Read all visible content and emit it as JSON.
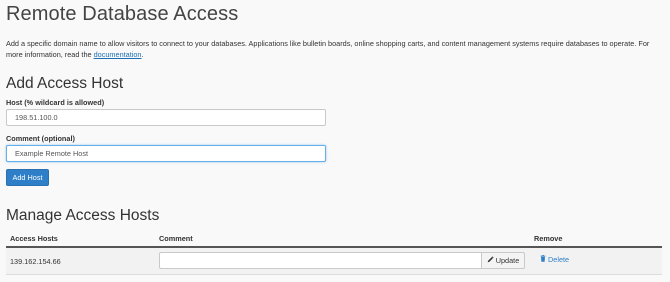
{
  "page": {
    "title": "Remote Database Access",
    "intro_text": "Add a specific domain name to allow visitors to connect to your databases. Applications like bulletin boards, online shopping carts, and content management systems require databases to operate. For more information, read the ",
    "intro_link": "documentation",
    "intro_end": "."
  },
  "add_section": {
    "heading": "Add Access Host",
    "host_label": "Host (% wildcard is allowed)",
    "host_value": "198.51.100.0",
    "comment_label": "Comment (optional)",
    "comment_value": "Example Remote Host",
    "add_button": "Add Host"
  },
  "manage_section": {
    "heading": "Manage Access Hosts",
    "columns": [
      "Access Hosts",
      "Comment",
      "Remove"
    ],
    "rows": [
      {
        "host": "139.162.154.66",
        "comment": "",
        "update_label": "Update",
        "delete_label": "Delete"
      }
    ]
  },
  "colors": {
    "primary": "#2e7fc7",
    "link": "#1a6fb5",
    "background": "#f9f9f9"
  },
  "icons": {
    "update": "pencil-icon",
    "delete": "trash-icon"
  }
}
